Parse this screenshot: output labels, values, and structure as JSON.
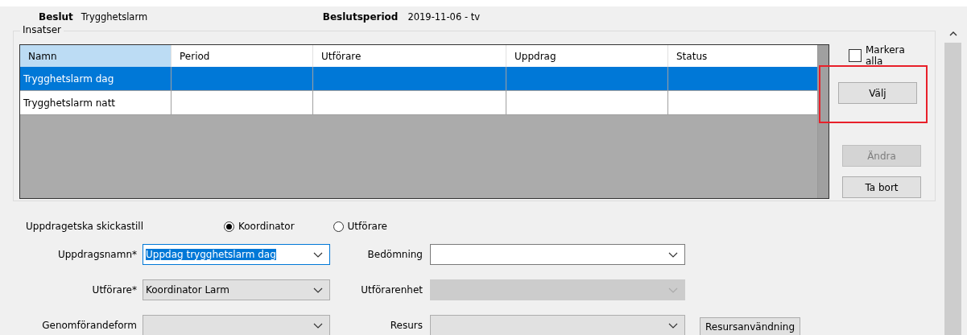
{
  "header": {
    "fields": [
      {
        "label": "Beslut",
        "value": "Trygghetslarm"
      },
      {
        "label": "Beslutsperiod",
        "value": "2019-11-06 - tv"
      }
    ]
  },
  "insatser": {
    "title": "Insatser",
    "columns": [
      "Namn",
      "Period",
      "Utförare",
      "Uppdrag",
      "Status"
    ],
    "rows": [
      {
        "namn": "Trygghetslarm dag",
        "selected": true
      },
      {
        "namn": "Trygghetslarm natt",
        "selected": false
      }
    ]
  },
  "mark_all": {
    "label": "Markera alla",
    "checked": false
  },
  "buttons": [
    {
      "label": "Välj",
      "disabled": false,
      "highlighted": true
    },
    {
      "label": "Ändra",
      "disabled": true,
      "highlighted": false
    },
    {
      "label": "Ta bort",
      "disabled": false,
      "highlighted": false
    }
  ],
  "send_to": {
    "label": "Uppdragetska skickastill",
    "options": [
      {
        "label": "Koordinator",
        "selected": true
      },
      {
        "label": "Utförare",
        "selected": false
      }
    ]
  },
  "form": {
    "rows": [
      [
        {
          "label": "Uppdragsnamn*",
          "value": "Uppdag trygghetslarm dag",
          "focused": true,
          "editable": true,
          "disabled": false
        },
        {
          "label": "Bedömning",
          "focused": false,
          "editable": true,
          "disabled": false
        }
      ],
      [
        {
          "label": "Utförare*",
          "value": "Koordinator Larm",
          "focused": false,
          "editable": false,
          "disabled": false
        },
        {
          "label": "Utförarenhet",
          "focused": false,
          "disabled": true
        }
      ],
      [
        {
          "label": "Genomförandeform",
          "focused": false,
          "editable": false,
          "disabled": false
        },
        {
          "label": "Resurs",
          "focused": false,
          "editable": false,
          "disabled": false
        }
      ]
    ],
    "extra_button": "Resursanvändning"
  }
}
